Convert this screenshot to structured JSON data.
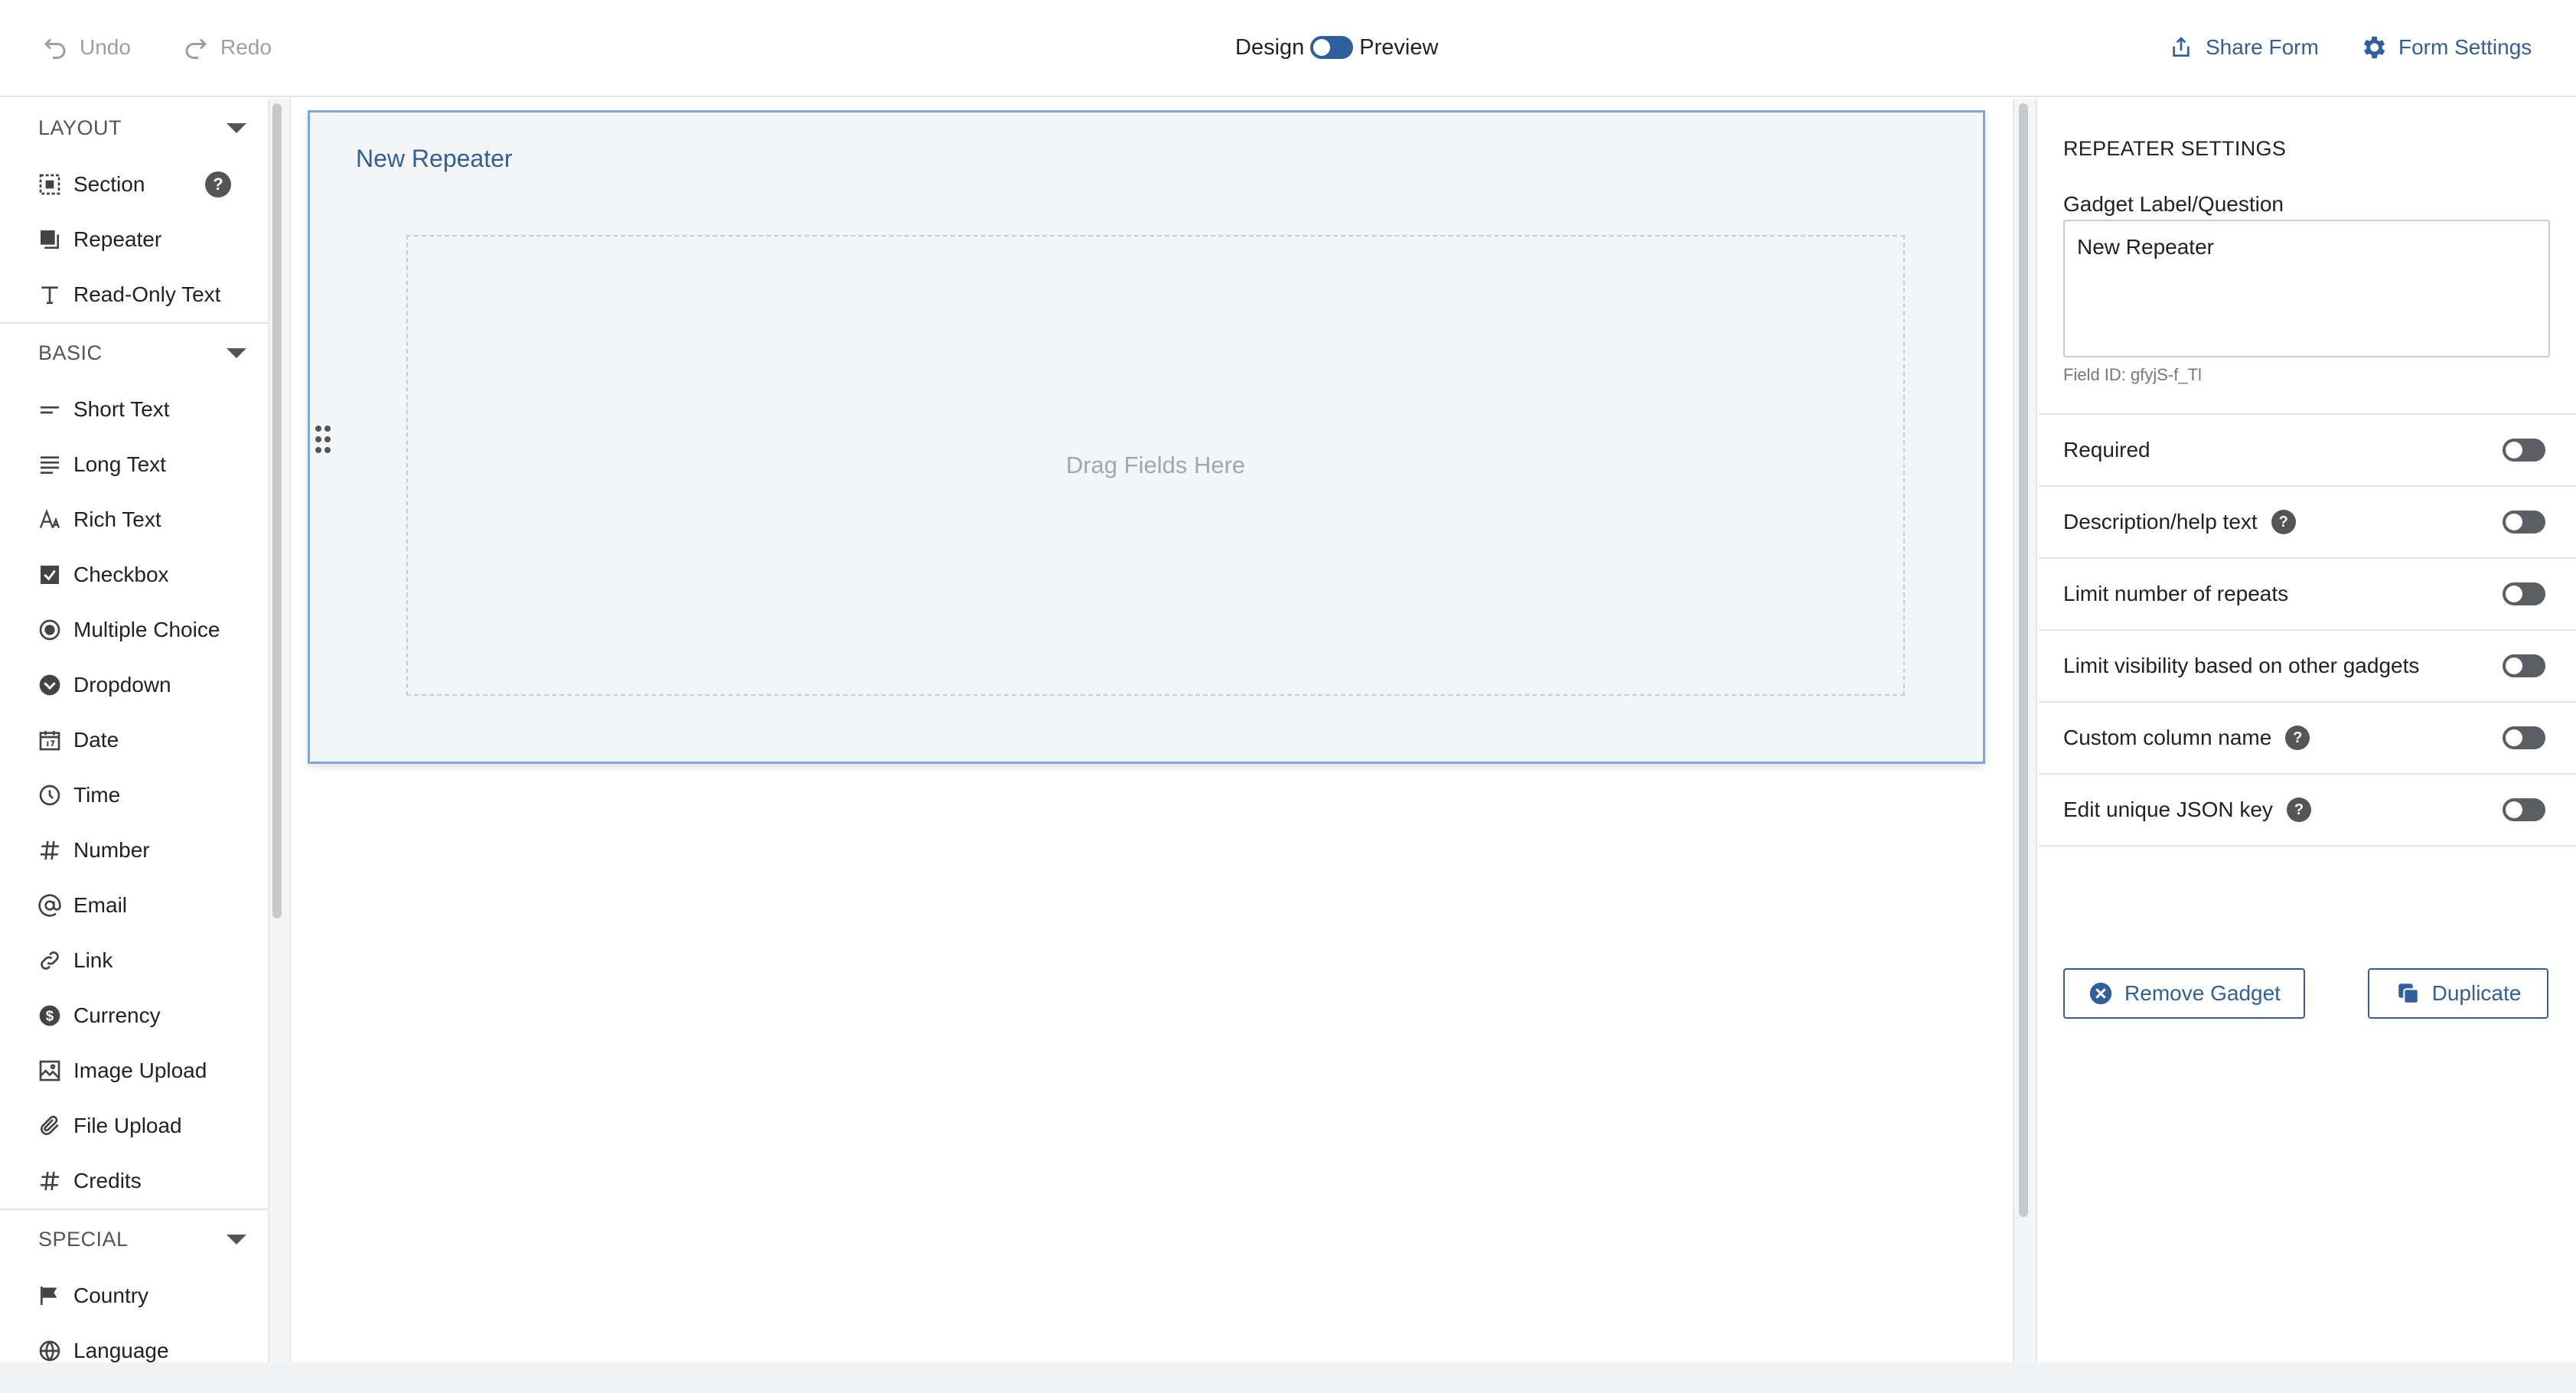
{
  "toolbar": {
    "undo_label": "Undo",
    "redo_label": "Redo",
    "design_label": "Design",
    "preview_label": "Preview",
    "share_label": "Share Form",
    "settings_label": "Form Settings"
  },
  "sidebar": {
    "groups": [
      {
        "title": "LAYOUT",
        "items": [
          {
            "label": "Section",
            "icon": "section-icon"
          },
          {
            "label": "Repeater",
            "icon": "repeater-icon"
          },
          {
            "label": "Read-Only Text",
            "icon": "text-icon"
          }
        ]
      },
      {
        "title": "BASIC",
        "items": [
          {
            "label": "Short Text",
            "icon": "short-text-icon"
          },
          {
            "label": "Long Text",
            "icon": "long-text-icon"
          },
          {
            "label": "Rich Text",
            "icon": "rich-text-icon"
          },
          {
            "label": "Checkbox",
            "icon": "checkbox-icon"
          },
          {
            "label": "Multiple Choice",
            "icon": "radio-icon"
          },
          {
            "label": "Dropdown",
            "icon": "dropdown-icon"
          },
          {
            "label": "Date",
            "icon": "calendar-icon"
          },
          {
            "label": "Time",
            "icon": "clock-icon"
          },
          {
            "label": "Number",
            "icon": "hash-icon"
          },
          {
            "label": "Email",
            "icon": "at-icon"
          },
          {
            "label": "Link",
            "icon": "link-icon"
          },
          {
            "label": "Currency",
            "icon": "dollar-icon"
          },
          {
            "label": "Image Upload",
            "icon": "image-icon"
          },
          {
            "label": "File Upload",
            "icon": "paperclip-icon"
          },
          {
            "label": "Credits",
            "icon": "hash-icon"
          }
        ]
      },
      {
        "title": "SPECIAL",
        "items": [
          {
            "label": "Country",
            "icon": "flag-icon"
          },
          {
            "label": "Language",
            "icon": "globe-icon"
          }
        ]
      }
    ],
    "help_glyph": "?"
  },
  "canvas": {
    "repeater_title": "New Repeater",
    "drop_text": "Drag Fields Here"
  },
  "panel": {
    "title": "REPEATER SETTINGS",
    "label_heading": "Gadget Label/Question",
    "label_value": "New Repeater",
    "field_id": "Field ID: gfyjS-f_Tl",
    "toggles": [
      {
        "label": "Required",
        "help": false,
        "on": false
      },
      {
        "label": "Description/help text",
        "help": true,
        "on": false
      },
      {
        "label": "Limit number of repeats",
        "help": false,
        "on": false
      },
      {
        "label": "Limit visibility based on other gadgets",
        "help": false,
        "on": false
      },
      {
        "label": "Custom column name",
        "help": true,
        "on": false
      },
      {
        "label": "Edit unique JSON key",
        "help": true,
        "on": false
      }
    ],
    "remove_label": "Remove Gadget",
    "duplicate_label": "Duplicate"
  },
  "colors": {
    "accent": "#2f5f9e",
    "selection_border": "#7fa6d9",
    "toggle_off": "#5b5e62"
  }
}
